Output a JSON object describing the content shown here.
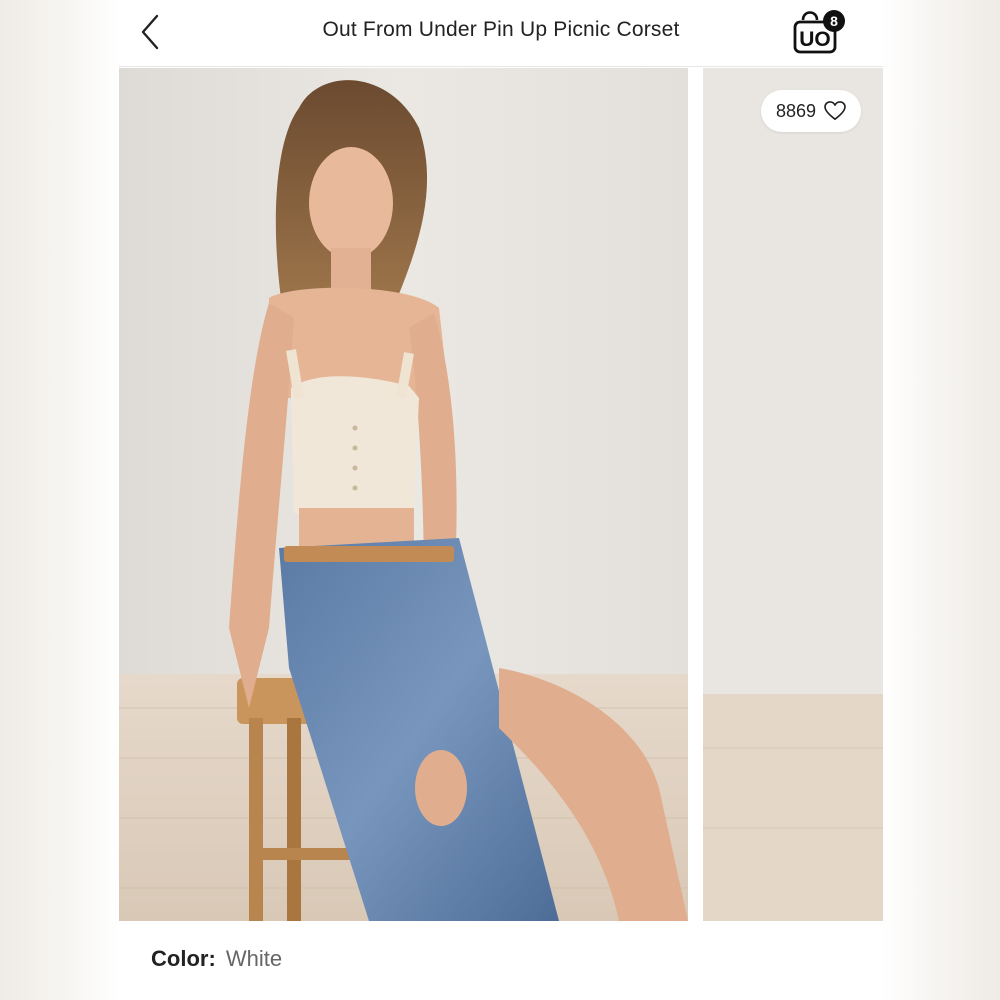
{
  "header": {
    "title": "Out From Under Pin Up Picnic Corset",
    "brand_logo_text": "UO",
    "cart_count": "8"
  },
  "gallery": {
    "favorites_count": "8869"
  },
  "product": {
    "color_label": "Color:",
    "color_value": "White"
  },
  "colors": {
    "background": "#ffffff",
    "text": "#222222",
    "muted": "#666666",
    "badge": "#111111"
  },
  "icons": {
    "back": "chevron-left-icon",
    "bag": "shopping-bag-icon",
    "favorite": "heart-outline-icon"
  }
}
